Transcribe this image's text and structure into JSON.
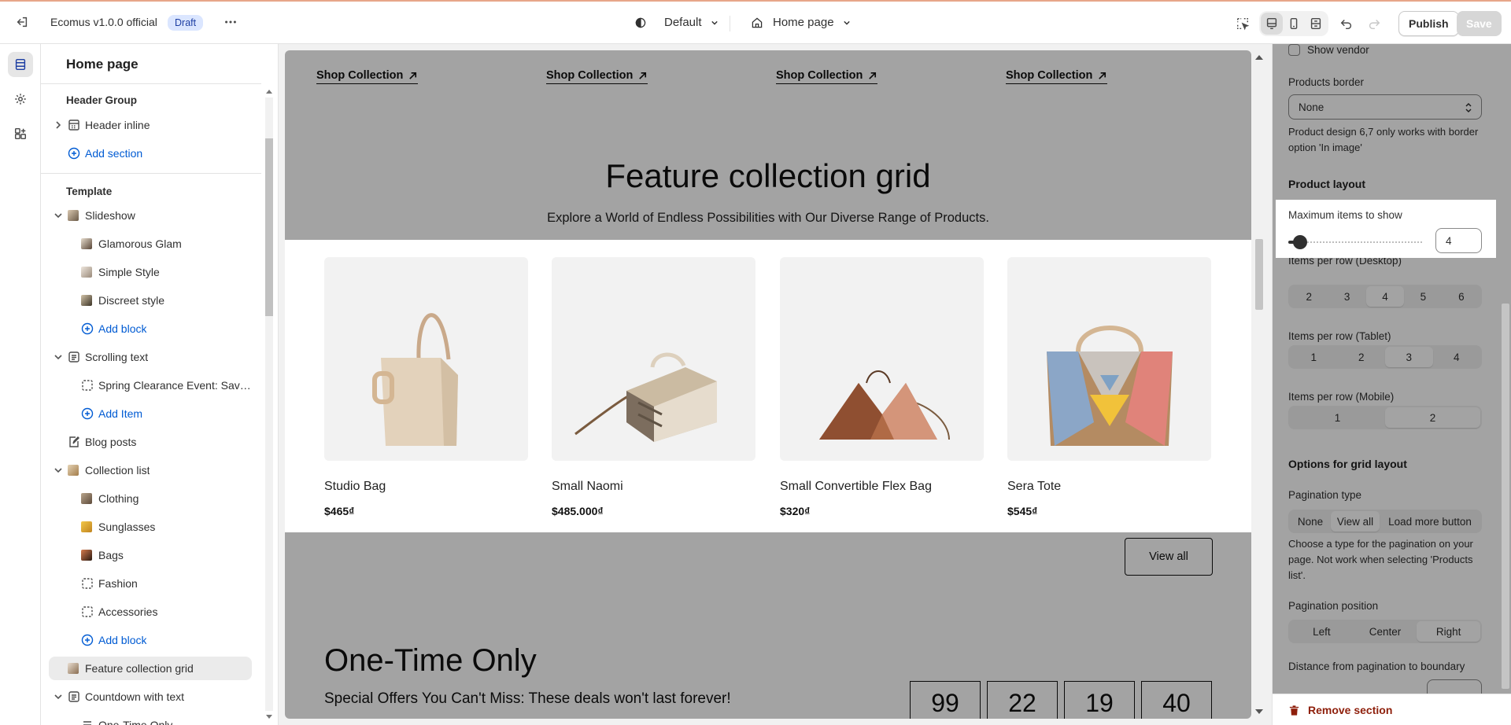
{
  "topbar": {
    "store_name": "Ecomus v1.0.0 official",
    "status_badge": "Draft",
    "theme_dropdown": "Default",
    "page_dropdown": "Home page",
    "publish_label": "Publish",
    "save_label": "Save"
  },
  "sidebar": {
    "title": "Home page",
    "header_group": {
      "label": "Header Group",
      "items": [
        {
          "label": "Header inline"
        }
      ],
      "add_label": "Add section"
    },
    "template_label": "Template",
    "sections": [
      {
        "label": "Slideshow",
        "children": [
          "Glamorous Glam",
          "Simple Style",
          "Discreet style"
        ],
        "add_label": "Add block"
      },
      {
        "label": "Scrolling text",
        "children": [
          "Spring Clearance Event: Save..."
        ],
        "add_label": "Add Item"
      },
      {
        "label": "Blog posts"
      },
      {
        "label": "Collection list",
        "children": [
          "Clothing",
          "Sunglasses",
          "Bags",
          "Fashion",
          "Accessories"
        ],
        "add_label": "Add block"
      },
      {
        "label": "Feature collection grid"
      },
      {
        "label": "Countdown with text",
        "children": [
          "One-Time Only"
        ]
      }
    ]
  },
  "preview": {
    "shop_links": [
      "Shop Collection",
      "Shop Collection",
      "Shop Collection",
      "Shop Collection"
    ],
    "feature_title": "Feature collection grid",
    "feature_subtitle": "Explore a World of Endless Possibilities with Our Diverse Range of Products.",
    "products": [
      {
        "name": "Studio Bag",
        "price": "$465₫"
      },
      {
        "name": "Small Naomi",
        "price": "$485.000₫"
      },
      {
        "name": "Small Convertible Flex Bag",
        "price": "$320₫"
      },
      {
        "name": "Sera Tote",
        "price": "$545₫"
      }
    ],
    "view_all_label": "View all",
    "countdown_title": "One-Time Only",
    "countdown_text": "Special Offers You Can't Miss: These deals won't last forever!",
    "countdown_values": [
      "99",
      "22",
      "19",
      "40"
    ]
  },
  "settings": {
    "show_vendor_label": "Show vendor",
    "products_border_label": "Products border",
    "products_border_value": "None",
    "products_border_help": "Product design 6,7 only works with border option 'In image'",
    "product_layout_heading": "Product layout",
    "max_items_label": "Maximum items to show",
    "max_items_value": "4",
    "max_items_fraction": 0.02,
    "items_desktop_label": "Items per row (Desktop)",
    "items_desktop_options": [
      "2",
      "3",
      "4",
      "5",
      "6"
    ],
    "items_desktop_selected": "4",
    "items_tablet_label": "Items per row (Tablet)",
    "items_tablet_options": [
      "1",
      "2",
      "3",
      "4"
    ],
    "items_tablet_selected": "3",
    "items_mobile_label": "Items per row (Mobile)",
    "items_mobile_options": [
      "1",
      "2"
    ],
    "items_mobile_selected": "2",
    "grid_options_heading": "Options for grid layout",
    "pagination_type_label": "Pagination type",
    "pagination_type_options": [
      "None",
      "View all",
      "Load more button"
    ],
    "pagination_type_selected": "View all",
    "pagination_type_help": "Choose a type for the pagination on your page. Not work when selecting 'Products list'.",
    "pagination_position_label": "Pagination position",
    "pagination_position_options": [
      "Left",
      "Center",
      "Right"
    ],
    "pagination_position_selected": "Right",
    "distance_label": "Distance from pagination to boundary",
    "remove_label": "Remove section"
  },
  "colors": {
    "accent_link": "#005bd3",
    "danger": "#8e1f0b",
    "draft_badge_bg": "#dbe6ff"
  }
}
